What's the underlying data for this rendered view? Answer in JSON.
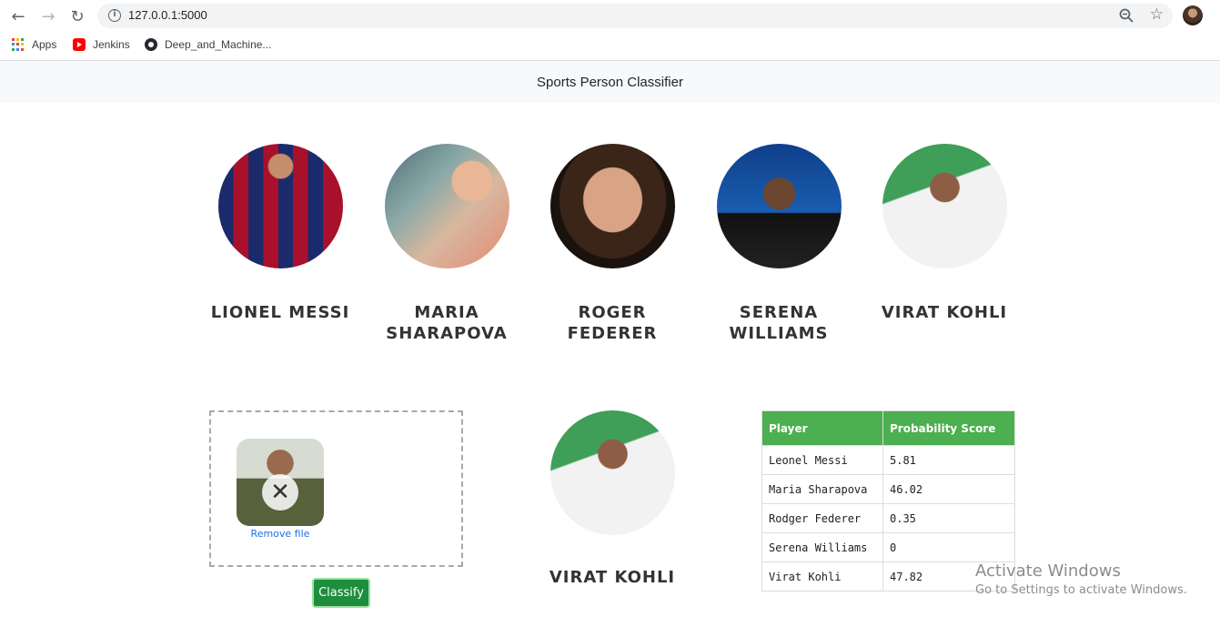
{
  "browser": {
    "url": "127.0.0.1:5000",
    "bookmarks": [
      {
        "label": "Apps",
        "icon": "apps-grid-icon"
      },
      {
        "label": "Jenkins",
        "icon": "youtube-icon"
      },
      {
        "label": "Deep_and_Machine...",
        "icon": "github-icon"
      }
    ]
  },
  "header": {
    "title": "Sports Person Classifier"
  },
  "players": [
    {
      "name": "LIONEL MESSI"
    },
    {
      "name": "MARIA SHARAPOVA"
    },
    {
      "name": "ROGER FEDERER"
    },
    {
      "name": "SERENA WILLIAMS"
    },
    {
      "name": "VIRAT KOHLI"
    }
  ],
  "upload": {
    "remove_label": "Remove file",
    "classify_label": "Classify"
  },
  "result": {
    "name": "VIRAT KOHLI"
  },
  "table": {
    "headers": [
      "Player",
      "Probability Score"
    ],
    "rows": [
      [
        "Leonel Messi",
        "5.81"
      ],
      [
        "Maria Sharapova",
        "46.02"
      ],
      [
        "Rodger Federer",
        "0.35"
      ],
      [
        "Serena Williams",
        "0"
      ],
      [
        "Virat Kohli",
        "47.82"
      ]
    ]
  },
  "watermark": {
    "line1": "Activate Windows",
    "line2": "Go to Settings to activate Windows."
  },
  "colors": {
    "table_header": "#4caf50",
    "classify_button": "#1e8e3e",
    "link": "#1a73e8"
  }
}
